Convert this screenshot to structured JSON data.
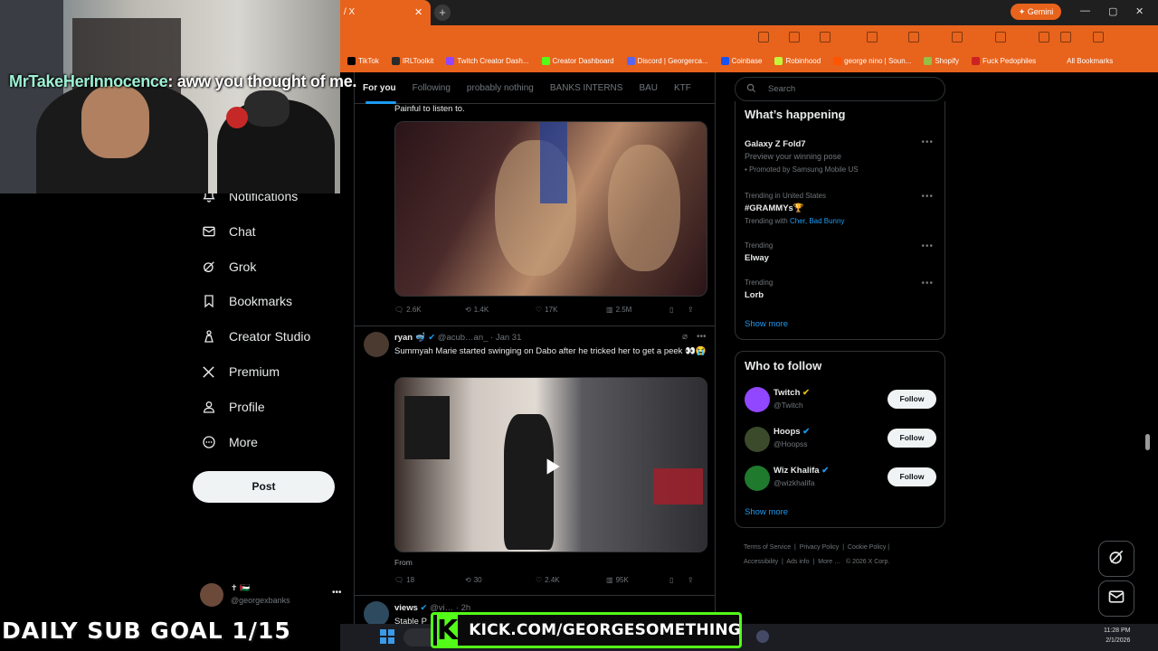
{
  "browser": {
    "active_tab_title": "/ X",
    "gemini_label": "Gemini",
    "bookmarks": [
      {
        "label": "TikTok",
        "color": "#000000"
      },
      {
        "label": "IRLToolkit",
        "color": "#2b2b2b"
      },
      {
        "label": "Twitch Creator Dash...",
        "color": "#9146ff"
      },
      {
        "label": "Creator Dashboard",
        "color": "#53fc18"
      },
      {
        "label": "Discord | Georgerca...",
        "color": "#5865f2"
      },
      {
        "label": "Coinbase",
        "color": "#1652f0"
      },
      {
        "label": "Robinhood",
        "color": "#c3f53c"
      },
      {
        "label": "george nino | Soun...",
        "color": "#ff5500"
      },
      {
        "label": "Shopify",
        "color": "#95bf47"
      },
      {
        "label": "Fuck Pedophiles",
        "color": "#cc2222"
      }
    ],
    "all_bookmarks": "All Bookmarks"
  },
  "nav": {
    "items": [
      {
        "label": "Notifications",
        "icon": "bell-icon"
      },
      {
        "label": "Chat",
        "icon": "mail-icon"
      },
      {
        "label": "Grok",
        "icon": "grok-icon"
      },
      {
        "label": "Bookmarks",
        "icon": "bookmark-icon"
      },
      {
        "label": "Creator Studio",
        "icon": "creator-studio-icon"
      },
      {
        "label": "Premium",
        "icon": "x-logo-icon"
      },
      {
        "label": "Profile",
        "icon": "person-icon"
      },
      {
        "label": "More",
        "icon": "more-circle-icon"
      }
    ],
    "post_button": "Post",
    "account_handle": "@georgexbanks",
    "account_name": "✝ 🇵🇸"
  },
  "feed": {
    "tabs": [
      "For you",
      "Following",
      "probably nothing",
      "BANKS INTERNS",
      "BAU",
      "KTF"
    ],
    "post1": {
      "text": "Painful to listen to.",
      "replies": "2.6K",
      "reposts": "1.4K",
      "likes": "17K",
      "views": "2.5M"
    },
    "post2": {
      "name": "ryan 🤿",
      "handle": "@acub…an_",
      "date": "· Jan 31",
      "text": "Summyah Marie started swinging on Dabo after he tricked her to get a peek 👀😭",
      "media_caption": "From",
      "replies": "18",
      "reposts": "30",
      "likes": "2.4K",
      "views": "95K"
    },
    "post3": {
      "name": "views",
      "handle": "@vi…",
      "date": "· 2h",
      "text": "Stable P"
    }
  },
  "sidebar": {
    "search_placeholder": "Search",
    "whats_happening": {
      "title": "What’s happening",
      "items": [
        {
          "meta": "",
          "name": "Galaxy Z Fold7",
          "sub": "Preview your winning pose",
          "promo": "Promoted by Samsung Mobile US"
        },
        {
          "meta": "Trending in United States",
          "name": "#GRAMMYs🏆",
          "sub": "Trending with",
          "links": "Cher, Bad Bunny"
        },
        {
          "meta": "Trending",
          "name": "Elway"
        },
        {
          "meta": "Trending",
          "name": "Lorb"
        }
      ],
      "show_more": "Show more"
    },
    "who_to_follow": {
      "title": "Who to follow",
      "accounts": [
        {
          "name": "Twitch",
          "handle": "@Twitch",
          "avatar_color": "#9146ff",
          "badge_color": "#e2b719"
        },
        {
          "name": "Hoops",
          "handle": "@Hoopss",
          "avatar_color": "#3a4a2a",
          "badge_color": "#1d9bf0"
        },
        {
          "name": "Wiz Khalifa",
          "handle": "@wizkhalifa",
          "avatar_color": "#1f7a2e",
          "badge_color": "#1d9bf0"
        }
      ],
      "follow_label": "Follow",
      "show_more": "Show more"
    },
    "footer": [
      "Terms of Service",
      "Privacy Policy",
      "Cookie Policy",
      "Accessibility",
      "Ads info",
      "More …",
      "© 2026 X Corp."
    ]
  },
  "overlay": {
    "chat_user": "MrTakeHerInnocence",
    "chat_message": ": aww you thought of me.",
    "sub_goal": "DAILY SUB GOAL 1/15",
    "kick_url": "KICK.COM/GEORGESOMETHING",
    "kick_letter": "K",
    "clock_time": "11:28 PM",
    "clock_date": "2/1/2026"
  },
  "colors": {
    "accent": "#1d9bf0",
    "browser_orange": "#e8631c",
    "kick_green": "#53fc18"
  }
}
